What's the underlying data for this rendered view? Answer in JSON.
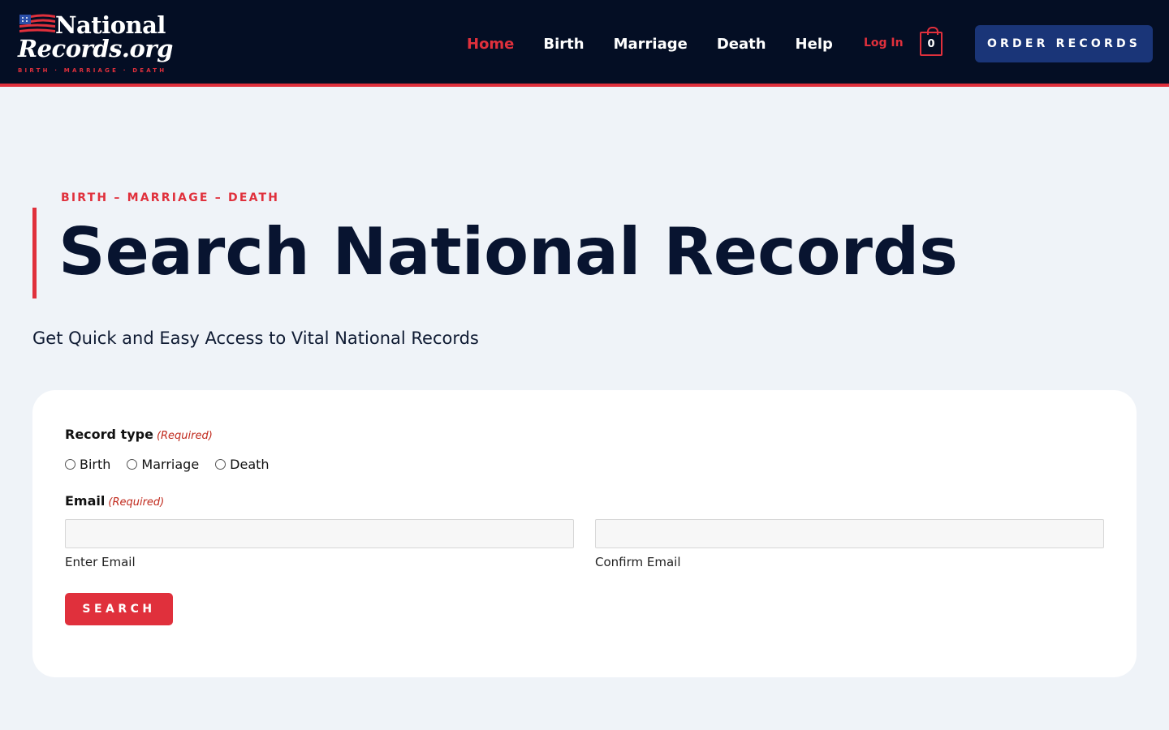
{
  "colors": {
    "header_bg": "#040e24",
    "accent_red": "#e0303c",
    "order_button_bg": "#1a3578",
    "page_bg": "#eff3f8",
    "card_bg": "#ffffff",
    "title_text": "#081430"
  },
  "logo": {
    "line1": "National",
    "line2": "Records.org",
    "tagline": "BIRTH · MARRIAGE · DEATH",
    "icon": "us-flag-icon"
  },
  "nav": {
    "items": [
      {
        "label": "Home",
        "active": true
      },
      {
        "label": "Birth",
        "active": false
      },
      {
        "label": "Marriage",
        "active": false
      },
      {
        "label": "Death",
        "active": false
      },
      {
        "label": "Help",
        "active": false
      }
    ],
    "login_label": "Log In",
    "cart_count": "0",
    "cart_icon": "shopping-bag-icon",
    "order_button_label": "ORDER RECORDS"
  },
  "hero": {
    "eyebrow": "BIRTH – MARRIAGE – DEATH",
    "title": "Search National Records",
    "subtitle": "Get Quick and Easy Access to Vital National Records"
  },
  "form": {
    "record_type_label": "Record type",
    "required_label": "(Required)",
    "record_type_options": [
      "Birth",
      "Marriage",
      "Death"
    ],
    "record_type_selected": "",
    "email_label": "Email",
    "email_value": "",
    "confirm_email_value": "",
    "enter_email_sublabel": "Enter Email",
    "confirm_email_sublabel": "Confirm Email",
    "search_button_label": "SEARCH"
  }
}
